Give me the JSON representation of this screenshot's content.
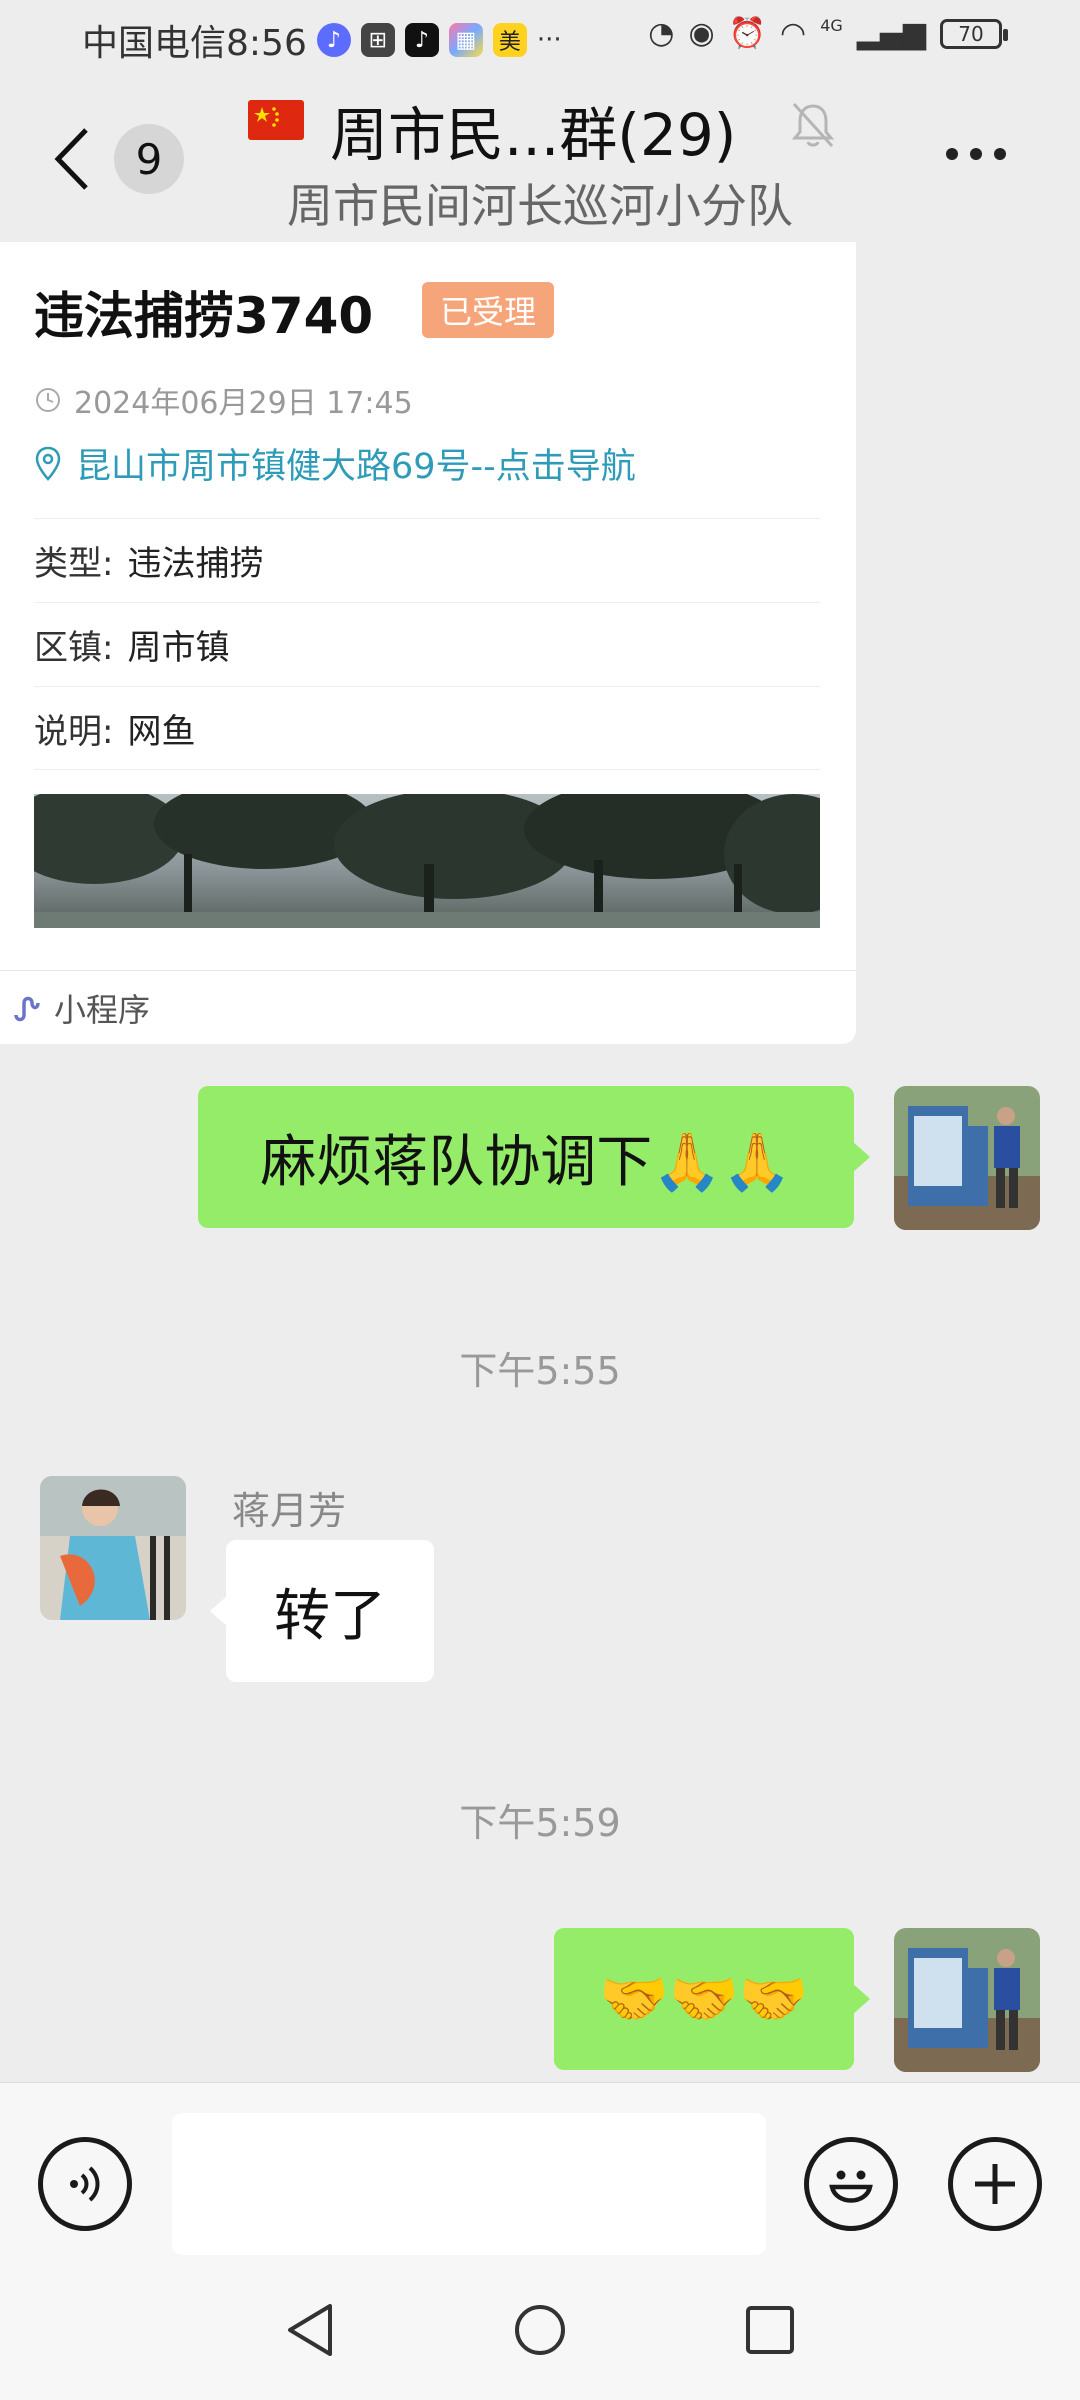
{
  "status_bar": {
    "carrier_time": "中国电信8:56",
    "app_icons": [
      "music-icon",
      "gift-icon",
      "tiktok-icon",
      "app-icon",
      "meituan-icon"
    ],
    "meituan_label": "美",
    "more_dots": "···",
    "battery": "70",
    "network": "4G"
  },
  "header": {
    "back_count": "9",
    "title": "周市民...群(29)",
    "subtitle": "周市民间河长巡河小分队",
    "muted": true
  },
  "card": {
    "title": "违法捕捞3740",
    "status": "已受理",
    "datetime": "2024年06月29日 17:45",
    "location": "昆山市周市镇健大路69号--点击导航",
    "fields": [
      {
        "key": "类型:",
        "value": "违法捕捞"
      },
      {
        "key": "区镇:",
        "value": "周市镇"
      },
      {
        "key": "说明:",
        "value": "网鱼"
      }
    ],
    "footer": "小程序"
  },
  "messages": {
    "m1_text": "麻烦蒋队协调下🙏🙏",
    "time1": "下午5:55",
    "m2_sender": "蒋月芳",
    "m2_text": "转了",
    "time2": "下午5:59",
    "m3_text": "🤝🤝🤝"
  },
  "input": {
    "placeholder": ""
  },
  "colors": {
    "bubble_green": "#95ec69",
    "link": "#2e9cb8",
    "tag": "#f6a57a",
    "background": "#ededed"
  }
}
